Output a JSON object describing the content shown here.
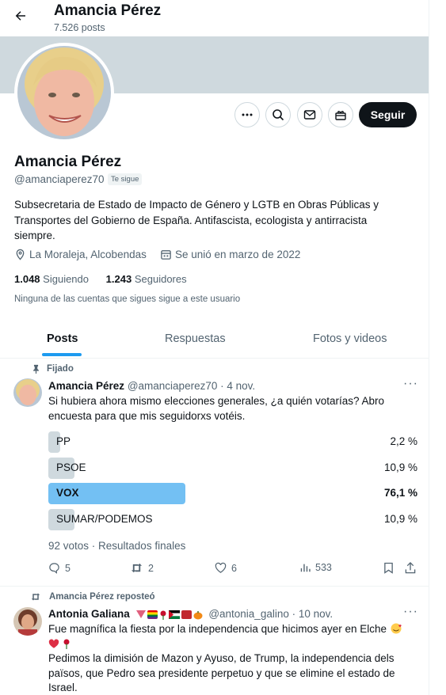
{
  "header": {
    "title": "Amancia Pérez",
    "post_count": "7.526 posts"
  },
  "profile": {
    "name": "Amancia Pérez",
    "handle": "@amanciaperez70",
    "follows_you": "Te sigue",
    "follow_button": "Seguir",
    "bio": "Subsecretaria de Estado de Impacto de Género y LGTB en Obras Públicas y Transportes del Gobierno de España. Antifascista, ecologista y antirracista siempre.",
    "location": "La Moraleja, Alcobendas",
    "joined": "Se unió en marzo de 2022",
    "following_count": "1.048",
    "following_label": "Siguiendo",
    "followers_count": "1.243",
    "followers_label": "Seguidores",
    "no_mutual": "Ninguna de las cuentas que sigues sigue a este usuario"
  },
  "tabs": [
    "Posts",
    "Respuestas",
    "Fotos y videos"
  ],
  "pinned_post": {
    "pinned_label": "Fijado",
    "author": "Amancia Pérez",
    "handle_date": "@amanciaperez70 · 4 nov.",
    "text": "Si hubiera ahora mismo elecciones generales, ¿a quién votarías? Abro encuesta para que mis seguidorxs votéis.",
    "poll": [
      {
        "label": "PP",
        "percent": "2,2 %",
        "share": 0.022
      },
      {
        "label": "PSOE",
        "percent": "10,9 %",
        "share": 0.109
      },
      {
        "label": "VOX",
        "percent": "76,1 %",
        "share": 0.761,
        "winner": true
      },
      {
        "label": "SUMAR/PODEMOS",
        "percent": "10,9 %",
        "share": 0.109
      }
    ],
    "poll_footer": "92 votos · Resultados finales",
    "replies": "5",
    "reposts": "2",
    "likes": "6",
    "views": "533"
  },
  "repost": {
    "repost_label": "Amancia Pérez reposteó",
    "author": "Antonia Galiana",
    "handle_date": "@antonia_galino · 10 nov.",
    "text_line1": "Fue magnífica la fiesta por la independencia que hicimos ayer en Elche",
    "text_body": "Pedimos la dimisión de Mazon y Ayuso, de Trump, la independencia dels països, que Pedro sea presidente perpetuo y que se elimine el estado de Israel."
  },
  "colors": {
    "accent": "#1d9bf0",
    "poll_winner": "#73c0f3",
    "poll_bar": "#cfd9de",
    "banner": "#cfd9de"
  }
}
